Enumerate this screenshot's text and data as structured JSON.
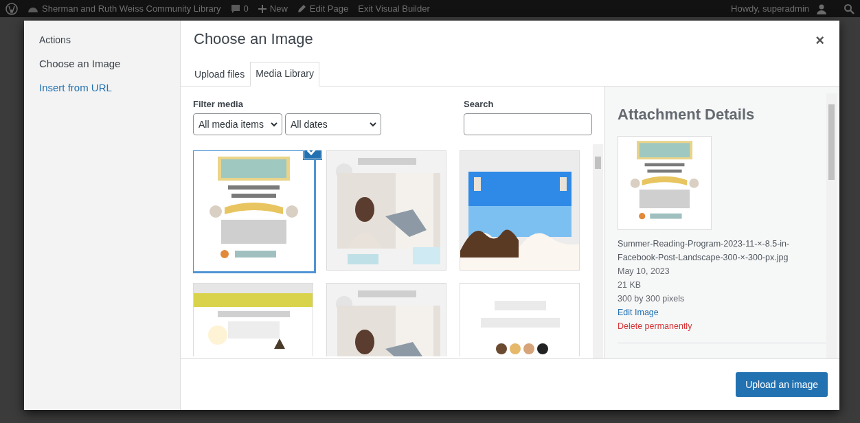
{
  "admin_bar": {
    "site_name": "Sherman and Ruth Weiss Community Library",
    "comments": "0",
    "new": "New",
    "edit": "Edit Page",
    "exit": "Exit Visual Builder",
    "greeting": "Howdy, superadmin"
  },
  "sidebar": {
    "heading": "Actions",
    "items": [
      {
        "label": "Choose an Image",
        "selected": true
      },
      {
        "label": "Insert from URL",
        "selected": false
      }
    ]
  },
  "modal": {
    "title": "Choose an Image",
    "close": "×",
    "tabs": [
      {
        "label": "Upload files",
        "selected": false
      },
      {
        "label": "Media Library",
        "selected": true
      }
    ],
    "filter_label": "Filter media",
    "filters": [
      "All media items",
      "All dates"
    ],
    "search_label": "Search",
    "media": [
      {
        "kind": "picture",
        "selected": true
      },
      {
        "kind": "picture",
        "selected": false
      },
      {
        "kind": "picture",
        "selected": false
      },
      {
        "kind": "picture",
        "selected": false
      },
      {
        "kind": "picture",
        "selected": false
      },
      {
        "kind": "picture",
        "selected": false
      }
    ]
  },
  "details": {
    "heading": "Attachment Details",
    "filename": "Summer-Reading-Program-2023-11-×-8.5-in-Facebook-Post-Landscape-300-×-300-px.jpg",
    "date": "May 10, 2023",
    "size": "21 KB",
    "dimensions": "300 by 300 pixels",
    "edit_link": "Edit Image",
    "delete_link": "Delete permanently"
  },
  "footer": {
    "button": "Upload an image"
  }
}
